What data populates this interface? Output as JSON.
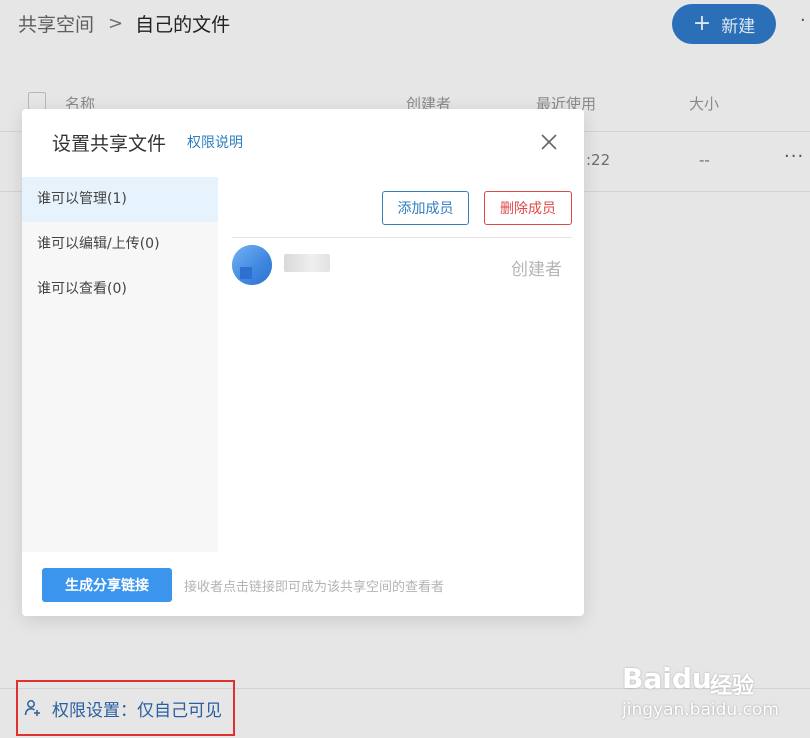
{
  "header": {
    "breadcrumb_root": "共享空间",
    "breadcrumb_sep": ">",
    "breadcrumb_current": "自己的文件",
    "new_label": "新建",
    "new_icon": "plus-icon"
  },
  "table": {
    "columns": [
      "名称",
      "创建者",
      "最近使用",
      "大小"
    ],
    "row": {
      "time_partial": ":22",
      "size": "--",
      "more": "···"
    }
  },
  "modal": {
    "title": "设置共享文件",
    "help_link": "权限说明",
    "close_icon": "close-icon",
    "side_items": [
      {
        "label": "谁可以管理(1)",
        "active": true
      },
      {
        "label": "谁可以编辑/上传(0)",
        "active": false
      },
      {
        "label": "谁可以查看(0)",
        "active": false
      }
    ],
    "add_member": "添加成员",
    "remove_member": "删除成员",
    "member": {
      "role": "创建者"
    },
    "share_button": "生成分享链接",
    "share_hint": "接收者点击链接即可成为该共享空间的查看者"
  },
  "footer": {
    "permission_label": "权限设置：仅自己可见",
    "permission_icon": "user-setting-icon"
  },
  "watermark": {
    "logo": "Baidu",
    "cn": "经验",
    "url": "jingyan.baidu.com"
  },
  "colors": {
    "accent": "#2f7fc1",
    "primary_button": "#3b95ec",
    "danger": "#e04848",
    "highlight_box": "#e03131"
  }
}
